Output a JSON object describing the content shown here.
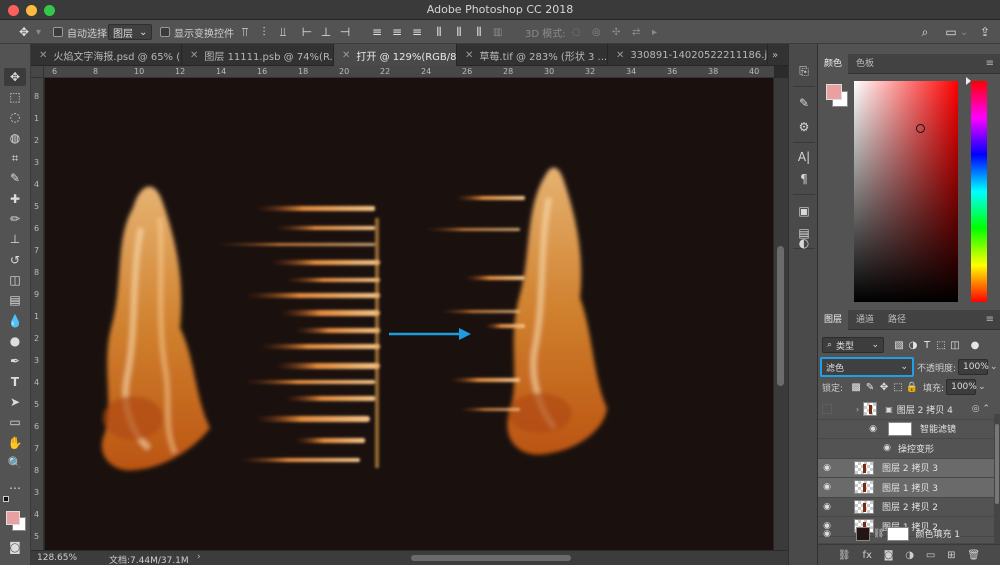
{
  "app": {
    "title": "Adobe Photoshop CC 2018"
  },
  "options": {
    "auto_select_label": "自动选择:",
    "auto_select_value": "图层",
    "show_transform_label": "显示变换控件",
    "mode_3d_label": "3D 模式:"
  },
  "tabs": [
    {
      "label": "火焰文字海报.psd @ 65% (..."
    },
    {
      "label": "图层 11111.psb @ 74%(R..."
    },
    {
      "label": "打开 @ 129%(RGB/8#) *"
    },
    {
      "label": "草莓.tif @ 283% (形状 3 ..."
    },
    {
      "label": "330891-14020522211186.j"
    }
  ],
  "tabs_more": "»",
  "ruler": {
    "top": [
      "6",
      "8",
      "10",
      "12",
      "14",
      "16",
      "18",
      "20",
      "22",
      "24",
      "26",
      "28",
      "30",
      "32",
      "34",
      "36",
      "38",
      "40"
    ],
    "left": [
      "8",
      "1",
      "2",
      "3",
      "4",
      "5",
      "6",
      "7",
      "8",
      "9",
      "1",
      "2",
      "3",
      "4",
      "5",
      "6",
      "7",
      "8",
      "3",
      "4",
      "5"
    ]
  },
  "status": {
    "zoom": "128.65%",
    "doc": "文档:7.44M/37.1M",
    "arrow": "›"
  },
  "color_panel": {
    "tabs": [
      "颜色",
      "色板"
    ],
    "fg_color": "#e9a0a0",
    "bg_color": "#ffffff"
  },
  "layers_panel": {
    "tabs": [
      "图层",
      "通道",
      "路径"
    ],
    "filter_label": "类型",
    "blend_mode": "滤色",
    "opacity_label": "不透明度:",
    "opacity_value": "100%",
    "lock_label": "锁定:",
    "fill_label": "填充:",
    "fill_value": "100%",
    "layers": [
      {
        "name": "图层 2 拷贝 4",
        "visible": false,
        "selected": false
      },
      {
        "name": "智能滤镜",
        "visible": true,
        "selected": false
      },
      {
        "name": "操控变形",
        "visible": true,
        "selected": false
      },
      {
        "name": "图层 2 拷贝 3",
        "visible": true,
        "selected": true
      },
      {
        "name": "图层 1 拷贝 3",
        "visible": true,
        "selected": true
      },
      {
        "name": "图层 2 拷贝 2",
        "visible": true,
        "selected": false
      },
      {
        "name": "图层 1 拷贝 2",
        "visible": true,
        "selected": false
      },
      {
        "name": "颜色填充 1",
        "visible": true,
        "selected": false
      }
    ]
  },
  "icons": {
    "move": "✥",
    "marquee": "⬚",
    "lasso": "◌",
    "quick_select": "◍",
    "crop": "⌗",
    "eyedropper": "✎",
    "heal": "✚",
    "brush": "✏",
    "stamp": "⊥",
    "history": "↺",
    "eraser": "◫",
    "gradient": "▤",
    "blur": "💧",
    "dodge": "●",
    "pen": "✒",
    "type": "T",
    "path_select": "➤",
    "shape": "▭",
    "hand": "✋",
    "zoom": "🔍",
    "more": "…",
    "quickmask": "◙",
    "screen": "▣",
    "search": "⌕",
    "workspace": "▭",
    "share": "⇪",
    "eye": "👁"
  },
  "colors": {
    "arrow": "#1e9ce0",
    "accent": "#1ea0e6"
  }
}
